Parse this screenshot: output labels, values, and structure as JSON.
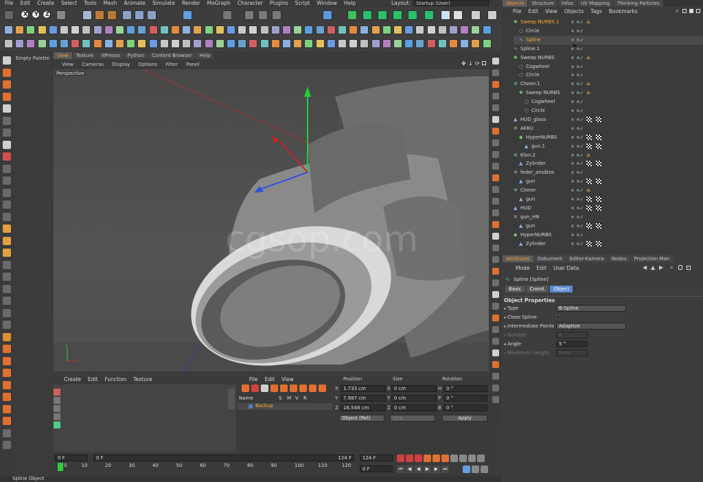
{
  "menubar": {
    "items": [
      "File",
      "Edit",
      "Create",
      "Select",
      "Tools",
      "Mesh",
      "Animate",
      "Simulate",
      "Render",
      "MoGraph",
      "Character",
      "Plugins",
      "Script",
      "Window",
      "Help"
    ],
    "layout_label": "Layout:",
    "layout_value": "Startup (User)"
  },
  "toolbar": {
    "coord_labels": [
      "X",
      "Y",
      "Z"
    ]
  },
  "left_panel": {
    "title": "Empty Palette"
  },
  "viewport": {
    "tabs": [
      "View",
      "Texture",
      "XPresso",
      "Python",
      "Content Browser",
      "Help"
    ],
    "menu": [
      "View",
      "Cameras",
      "Display",
      "Options",
      "Filter",
      "Panel"
    ],
    "camera_label": "Perspective",
    "watermark": "cgsop.com",
    "axis_y": "Y",
    "axis_x": "X"
  },
  "material_panel": {
    "menu": [
      "Create",
      "Edit",
      "Function",
      "Texture"
    ]
  },
  "layer_panel": {
    "menu": [
      "File",
      "Edit",
      "View"
    ],
    "columns": [
      "Name",
      "S",
      "M",
      "V",
      "R"
    ],
    "row_name": "Backup"
  },
  "coords": {
    "headers": [
      "Position",
      "Size",
      "Rotation"
    ],
    "rows": [
      {
        "axis": "X",
        "pos": "1.733 cm",
        "size_axis": "X",
        "size": "0 cm",
        "rot_axis": "H",
        "rot": "0 °"
      },
      {
        "axis": "Y",
        "pos": "7.987 cm",
        "size_axis": "Y",
        "size": "0 cm",
        "rot_axis": "P",
        "rot": "0 °"
      },
      {
        "axis": "Z",
        "pos": "16.548 cm",
        "size_axis": "Z",
        "size": "0 cm",
        "rot_axis": "B",
        "rot": "0 °"
      }
    ],
    "mode": "Object (Rel)",
    "size_mode": "Size",
    "apply": "Apply"
  },
  "timeline": {
    "start_frame": "0 F",
    "current_frame": "0 F",
    "end_frame_label": "124 F",
    "end_frame": "124 F",
    "ticks": [
      "0",
      "10",
      "20",
      "30",
      "40",
      "50",
      "60",
      "70",
      "80",
      "90",
      "100",
      "110",
      "120"
    ],
    "frame_field": "0 F"
  },
  "statusbar": {
    "text": "Spline Object"
  },
  "objects_panel": {
    "tabs": [
      "Objects",
      "Structure",
      "Infos",
      "UV Mapping",
      "Thinking Particles"
    ],
    "menu": [
      "File",
      "Edit",
      "View",
      "Objects",
      "Tags",
      "Bookmarks"
    ],
    "rows": [
      {
        "name": "Sweep NURBS.1",
        "indent": 0,
        "highlight": true
      },
      {
        "name": "Circle",
        "indent": 1
      },
      {
        "name": "Spline",
        "indent": 1,
        "selected": true
      },
      {
        "name": "Spline.1",
        "indent": 0
      },
      {
        "name": "Sweep NURBS",
        "indent": 0
      },
      {
        "name": "Cogwheel",
        "indent": 1
      },
      {
        "name": "Circle",
        "indent": 1
      },
      {
        "name": "Cloner.1",
        "indent": 0
      },
      {
        "name": "Sweep NURBS",
        "indent": 1
      },
      {
        "name": "Cogwheel",
        "indent": 2
      },
      {
        "name": "Circle",
        "indent": 2
      },
      {
        "name": "HUD_glass",
        "indent": 0
      },
      {
        "name": "AKKU",
        "indent": 0
      },
      {
        "name": "HyperNURBS",
        "indent": 1
      },
      {
        "name": "gun.1",
        "indent": 2
      },
      {
        "name": "Klon.2",
        "indent": 0
      },
      {
        "name": "Zylinder",
        "indent": 1
      },
      {
        "name": "feder_ansätze",
        "indent": 0
      },
      {
        "name": "gun",
        "indent": 1
      },
      {
        "name": "Cloner",
        "indent": 0
      },
      {
        "name": "gun",
        "indent": 1
      },
      {
        "name": "HUD",
        "indent": 0
      },
      {
        "name": "gun_HN",
        "indent": 0
      },
      {
        "name": "gun",
        "indent": 1
      },
      {
        "name": "HyperNURBS",
        "indent": 0
      },
      {
        "name": "Zylinder",
        "indent": 1
      }
    ]
  },
  "attributes_panel": {
    "tabs": [
      "Attributes",
      "Dokument",
      "Editor-Kamera",
      "Nodes",
      "Projection Man"
    ],
    "menu": [
      "Mode",
      "Edit",
      "User Data"
    ],
    "object_title": "Spline [Spline]",
    "subtabs": [
      "Basic",
      "Coord.",
      "Object"
    ],
    "section": "Object Properties",
    "props": [
      {
        "label": "Type",
        "value": "B-Spline",
        "kind": "dropdown"
      },
      {
        "label": "Close Spline",
        "value": "",
        "kind": "checkbox"
      },
      {
        "label": "Intermediate Points",
        "value": "Adaptive",
        "kind": "dropdown"
      },
      {
        "label": "Number",
        "value": "8",
        "kind": "disabled"
      },
      {
        "label": "Angle",
        "value": "5 °",
        "kind": "field"
      },
      {
        "label": "Maximum Length",
        "value": "5 cm",
        "kind": "disabled"
      }
    ]
  }
}
